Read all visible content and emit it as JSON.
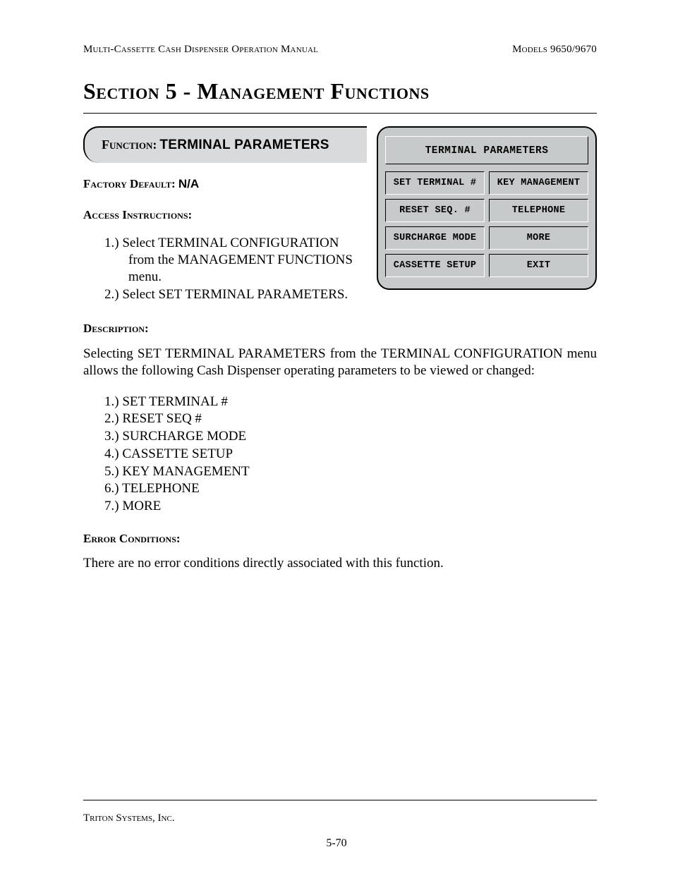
{
  "header": {
    "left": "Multi-Cassette Cash Dispenser Operation Manual",
    "right": "Models 9650/9670"
  },
  "section_title": "Section 5 - Management Functions",
  "function": {
    "label": "Function:",
    "name": "TERMINAL PARAMETERS"
  },
  "factory_default": {
    "label": "Factory Default:",
    "value": "N/A"
  },
  "access": {
    "label": "Access Instructions:",
    "steps": [
      "Select TERMINAL CONFIGURATION from the MANAGEMENT FUNCTIONS menu.",
      "Select SET TERMINAL PARAMETERS."
    ]
  },
  "description": {
    "label": "Description:",
    "body": "Selecting SET TERMINAL PARAMETERS from the TERMINAL CONFIGURATION menu allows the following Cash Dispenser operating parameters to be viewed or changed:",
    "list": [
      "SET TERMINAL #",
      "RESET SEQ #",
      "SURCHARGE MODE",
      "CASSETTE SETUP",
      "KEY MANAGEMENT",
      "TELEPHONE",
      "MORE"
    ]
  },
  "error": {
    "label": "Error Conditions:",
    "body": "There are no error conditions directly associated with this function."
  },
  "atm": {
    "title": "TERMINAL PARAMETERS",
    "buttons": [
      "SET TERMINAL #",
      "KEY MANAGEMENT",
      "RESET SEQ. #",
      "TELEPHONE",
      "SURCHARGE MODE",
      "MORE",
      "CASSETTE SETUP",
      "EXIT"
    ]
  },
  "footer": {
    "company": "Triton Systems, Inc.",
    "page": "5-70"
  }
}
